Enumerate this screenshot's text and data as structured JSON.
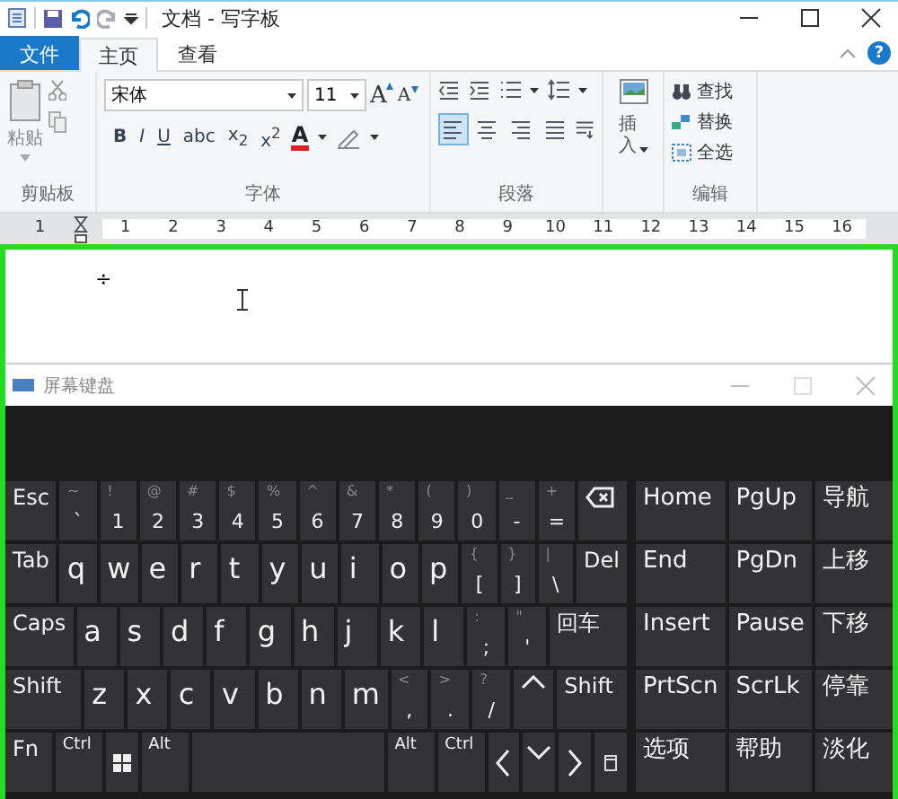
{
  "window": {
    "title": "文档 - 写字板"
  },
  "ribbon": {
    "tabs": [
      {
        "label": "文件",
        "kind": "file",
        "selected": false
      },
      {
        "label": "主页",
        "kind": "tab",
        "selected": true
      },
      {
        "label": "查看",
        "kind": "tab",
        "selected": false
      }
    ],
    "help": "?",
    "clipboard": {
      "paste": "粘贴",
      "label": "剪贴板"
    },
    "font": {
      "family": "宋体",
      "size": "11",
      "sizers": [
        "A",
        "A"
      ],
      "formats": [
        "B",
        "I",
        "U",
        "abc",
        "x$_{2}$",
        "x$^{2}$"
      ],
      "color_label": "A",
      "label": "字体"
    },
    "paragraph": {
      "label": "段落",
      "alignments": [
        {
          "selected": true
        },
        {
          "selected": false
        },
        {
          "selected": false
        },
        {
          "selected": false
        }
      ]
    },
    "insert": {
      "label": "插入"
    },
    "editing": {
      "label": "编辑",
      "items": [
        "查找",
        "替换",
        "全选"
      ]
    }
  },
  "ruler": {
    "lead": "1",
    "marks": [
      "1",
      "2",
      "3",
      "4",
      "5",
      "6",
      "7",
      "8",
      "9",
      "10",
      "11",
      "12",
      "13",
      "14",
      "15",
      "16"
    ]
  },
  "document": {
    "text": "÷"
  },
  "keyboard": {
    "title": "屏幕键盘",
    "lines": [
      {
        "keys": [
          {
            "kind": "command",
            "label": "Esc"
          },
          {
            "kind": "symbol",
            "shift": "~",
            "label": "`"
          },
          {
            "kind": "symbol",
            "shift": "!",
            "label": "1"
          },
          {
            "kind": "symbol",
            "shift": "@",
            "label": "2"
          },
          {
            "kind": "symbol",
            "shift": "#",
            "label": "3"
          },
          {
            "kind": "symbol",
            "shift": "$",
            "label": "4"
          },
          {
            "kind": "symbol",
            "shift": "%",
            "label": "5"
          },
          {
            "kind": "symbol",
            "shift": "^",
            "label": "6"
          },
          {
            "kind": "symbol",
            "shift": "&",
            "label": "7"
          },
          {
            "kind": "symbol",
            "shift": "*",
            "label": "8"
          },
          {
            "kind": "symbol",
            "shift": "(",
            "label": "9"
          },
          {
            "kind": "symbol",
            "shift": ")",
            "label": "0"
          },
          {
            "kind": "symbol",
            "shift": "_",
            "label": "-"
          },
          {
            "kind": "symbol",
            "shift": "+",
            "label": "="
          },
          {
            "kind": "backspace"
          }
        ]
      },
      {
        "keys": [
          {
            "kind": "command",
            "label": "Tab"
          },
          {
            "kind": "letter",
            "label": "q"
          },
          {
            "kind": "letter",
            "label": "w"
          },
          {
            "kind": "letter",
            "label": "e"
          },
          {
            "kind": "letter",
            "label": "r"
          },
          {
            "kind": "letter",
            "label": "t"
          },
          {
            "kind": "letter",
            "label": "y"
          },
          {
            "kind": "letter",
            "label": "u"
          },
          {
            "kind": "letter",
            "label": "i"
          },
          {
            "kind": "letter",
            "label": "o"
          },
          {
            "kind": "letter",
            "label": "p"
          },
          {
            "kind": "symbol",
            "shift": "{",
            "label": "["
          },
          {
            "kind": "symbol",
            "shift": "}",
            "label": "]"
          },
          {
            "kind": "symbol",
            "shift": "|",
            "label": "\\"
          },
          {
            "kind": "command",
            "label": "Del"
          }
        ]
      },
      {
        "keys": [
          {
            "kind": "command",
            "label": "Caps"
          },
          {
            "kind": "letter",
            "label": "a"
          },
          {
            "kind": "letter",
            "label": "s"
          },
          {
            "kind": "letter",
            "label": "d"
          },
          {
            "kind": "letter",
            "label": "f"
          },
          {
            "kind": "letter",
            "label": "g"
          },
          {
            "kind": "letter",
            "label": "h"
          },
          {
            "kind": "letter",
            "label": "j"
          },
          {
            "kind": "letter",
            "label": "k"
          },
          {
            "kind": "letter",
            "label": "l"
          },
          {
            "kind": "symbol",
            "shift": ":",
            "label": ";"
          },
          {
            "kind": "symbol",
            "shift": "\"",
            "label": "'"
          },
          {
            "kind": "command",
            "label": "回车"
          }
        ]
      },
      {
        "keys": [
          {
            "kind": "command",
            "label": "Shift"
          },
          {
            "kind": "letter",
            "label": "z"
          },
          {
            "kind": "letter",
            "label": "x"
          },
          {
            "kind": "letter",
            "label": "c"
          },
          {
            "kind": "letter",
            "label": "v"
          },
          {
            "kind": "letter",
            "label": "b"
          },
          {
            "kind": "letter",
            "label": "n"
          },
          {
            "kind": "letter",
            "label": "m"
          },
          {
            "kind": "symbol",
            "shift": "<",
            "label": ","
          },
          {
            "kind": "symbol",
            "shift": ">",
            "label": "."
          },
          {
            "kind": "symbol",
            "shift": "?",
            "label": "/"
          },
          {
            "kind": "up"
          },
          {
            "kind": "command",
            "label": "Shift"
          }
        ]
      },
      {
        "keys": [
          {
            "kind": "command",
            "label": "Fn"
          },
          {
            "kind": "small",
            "label": "Ctrl"
          },
          {
            "kind": "windows"
          },
          {
            "kind": "small",
            "label": "Alt"
          },
          {
            "kind": "space"
          },
          {
            "kind": "small",
            "label": "Alt"
          },
          {
            "kind": "small",
            "label": "Ctrl"
          },
          {
            "kind": "left"
          },
          {
            "kind": "down"
          },
          {
            "kind": "right"
          },
          {
            "kind": "menu"
          }
        ]
      }
    ],
    "side": [
      [
        "Home",
        "PgUp",
        "导航"
      ],
      [
        "End",
        "PgDn",
        "上移"
      ],
      [
        "Insert",
        "Pause",
        "下移"
      ],
      [
        "PrtScn",
        "ScrLk",
        "停靠"
      ],
      [
        "选项",
        "帮助",
        "淡化"
      ]
    ]
  }
}
